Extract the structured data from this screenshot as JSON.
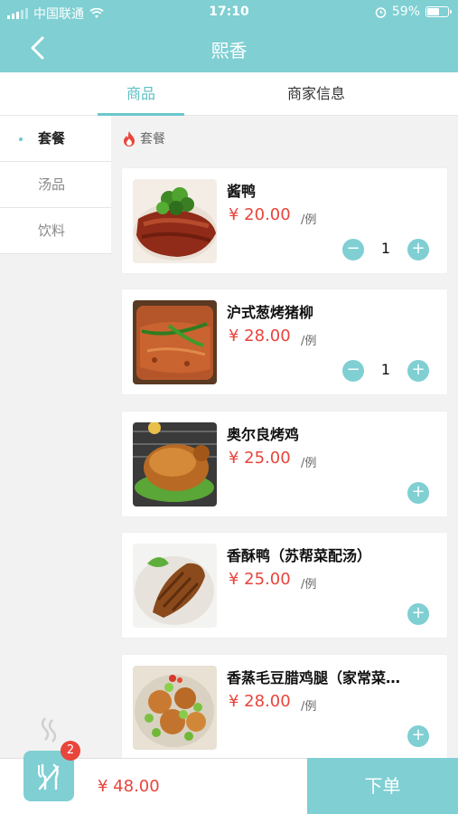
{
  "status_bar": {
    "carrier": "中国联通",
    "time": "17:10",
    "battery": "59%",
    "battery_level": 0.59
  },
  "nav": {
    "title": "熙香"
  },
  "tabs": [
    {
      "label": "商品",
      "active": true
    },
    {
      "label": "商家信息",
      "active": false
    }
  ],
  "categories": [
    {
      "label": "套餐",
      "active": true
    },
    {
      "label": "汤品",
      "active": false
    },
    {
      "label": "饮料",
      "active": false
    }
  ],
  "section": {
    "title": "套餐",
    "icon": "flame-icon"
  },
  "products": [
    {
      "name": "酱鸭",
      "price": "¥ 20.00",
      "unit": "/例",
      "minus": "−",
      "qty": "1",
      "plus": "+"
    },
    {
      "name": "沪式葱烤猪柳",
      "price": "¥ 28.00",
      "unit": "/例",
      "minus": "−",
      "qty": "1",
      "plus": "+"
    },
    {
      "name": "奥尔良烤鸡",
      "price": "¥ 25.00",
      "unit": "/例",
      "plus": "+"
    },
    {
      "name": "香酥鸭（苏帮菜配汤）",
      "price": "¥ 25.00",
      "unit": "/例",
      "plus": "+"
    },
    {
      "name": "香蒸毛豆腊鸡腿（家常菜…",
      "price": "¥ 28.00",
      "unit": "/例",
      "plus": "+"
    }
  ],
  "cart": {
    "badge": "2",
    "total": "¥ 48.00",
    "order_label": "下单"
  },
  "colors": {
    "accent": "#7fcfd3",
    "price": "#e8453c",
    "badge": "#e8453c"
  }
}
